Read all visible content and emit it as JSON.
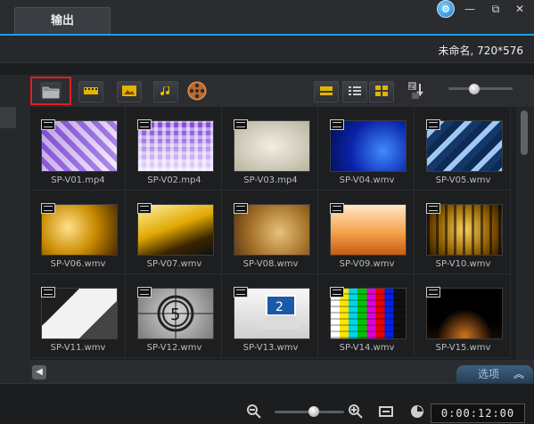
{
  "tabs": [
    {
      "label": "输出"
    }
  ],
  "window_controls": {
    "help_icon": "help-ball-icon",
    "minimize": "—",
    "restore": "⧉",
    "close": "✕"
  },
  "project": {
    "info": "未命名, 720*576"
  },
  "toolbar": {
    "buttons": [
      "folder-icon",
      "video-filter-icon",
      "image-filter-icon",
      "audio-filter-icon",
      "film-reel-icon",
      "view-thumbnail-icon",
      "view-list-icon",
      "view-grid-icon",
      "sort-icon"
    ]
  },
  "library": {
    "items": [
      {
        "label": "SP-V01.mp4"
      },
      {
        "label": "SP-V02.mp4"
      },
      {
        "label": "SP-V03.mp4"
      },
      {
        "label": "SP-V04.wmv"
      },
      {
        "label": "SP-V05.wmv"
      },
      {
        "label": "SP-V06.wmv"
      },
      {
        "label": "SP-V07.wmv"
      },
      {
        "label": "SP-V08.wmv"
      },
      {
        "label": "SP-V09.wmv"
      },
      {
        "label": "SP-V10.wmv"
      },
      {
        "label": "SP-V11.wmv"
      },
      {
        "label": "SP-V12.wmv"
      },
      {
        "label": "SP-V13.wmv"
      },
      {
        "label": "SP-V14.wmv"
      },
      {
        "label": "SP-V15.wmv"
      }
    ]
  },
  "options_tab": {
    "label": "选项"
  },
  "bottom": {
    "zoom_out": "−",
    "zoom_in": "+",
    "fit": "↔",
    "timecode": "0:00:12:00"
  },
  "colors": {
    "accent": "#1aa0e8",
    "highlight": "#e01e1e"
  }
}
